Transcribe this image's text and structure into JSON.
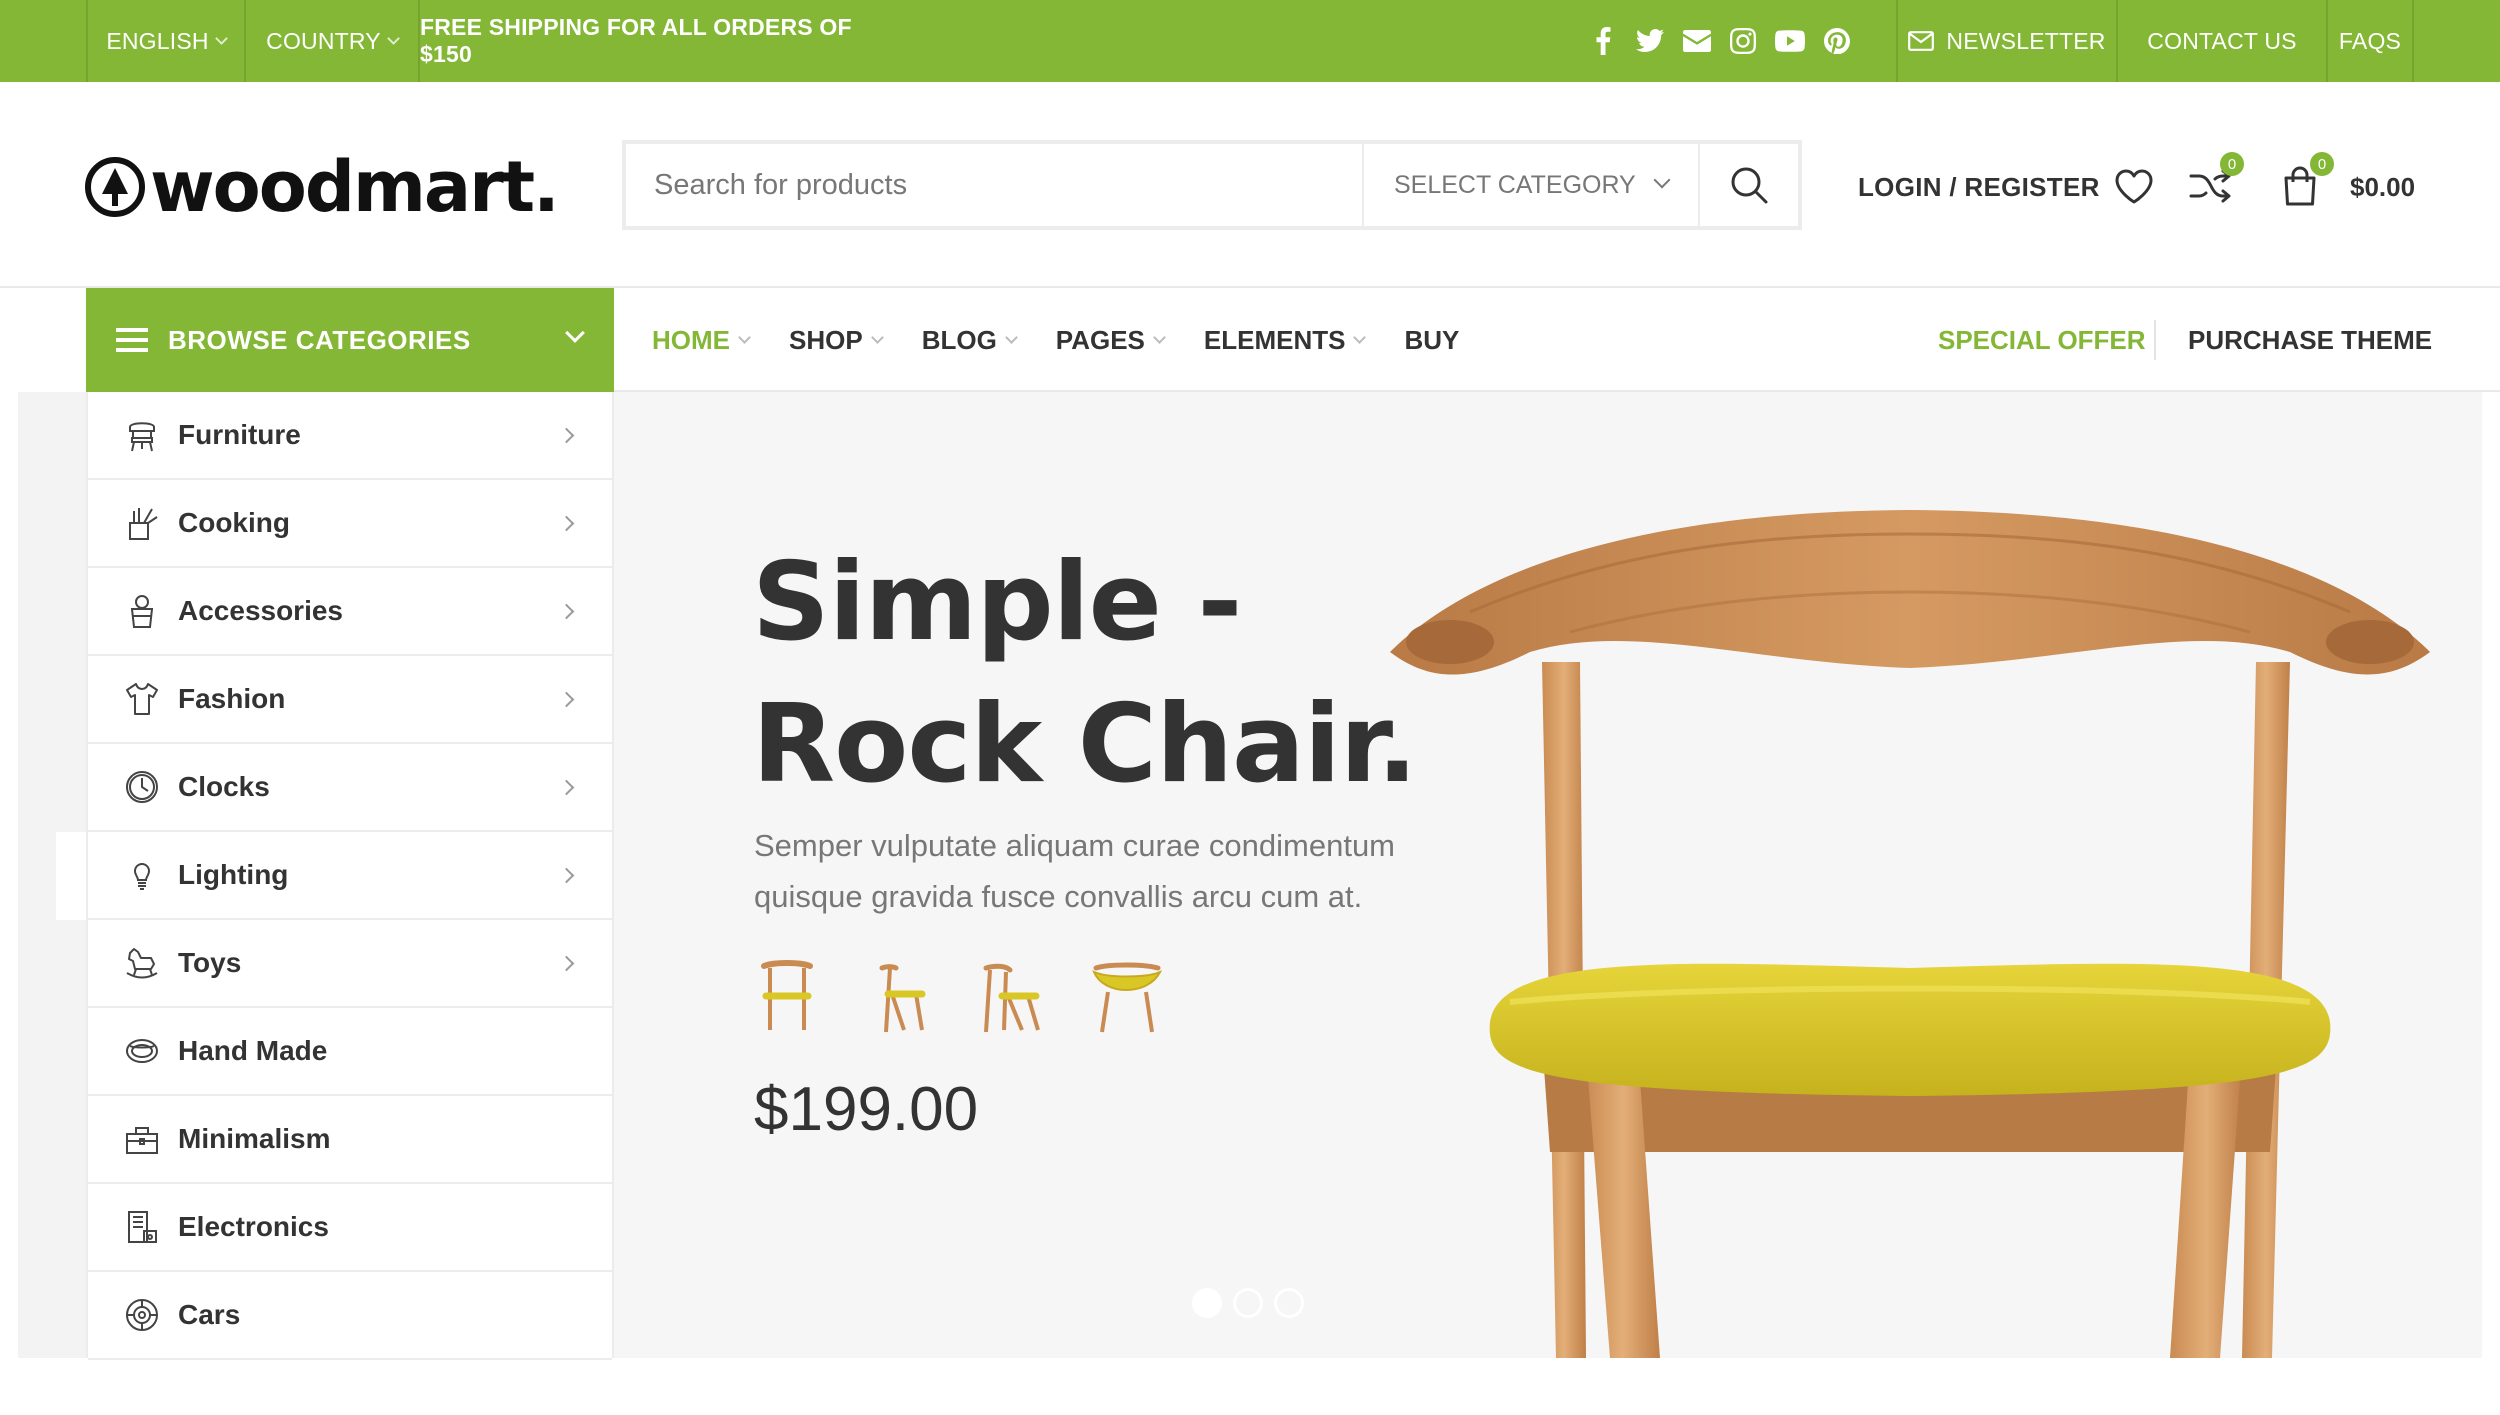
{
  "topbar": {
    "language": "ENGLISH",
    "country": "COUNTRY",
    "shipping": "FREE SHIPPING FOR ALL ORDERS OF $150",
    "socials": [
      "facebook-icon",
      "twitter-icon",
      "email-icon",
      "instagram-icon",
      "youtube-icon",
      "pinterest-icon"
    ],
    "newsletter": "NEWSLETTER",
    "contact": "CONTACT US",
    "faqs": "FAQS"
  },
  "header": {
    "logo": "woodmart.",
    "search_placeholder": "Search for products",
    "category_select": "SELECT CATEGORY",
    "login": "LOGIN / REGISTER",
    "compare_count": "0",
    "cart_count": "0",
    "cart_total": "$0.00"
  },
  "browse": {
    "label": "BROWSE CATEGORIES"
  },
  "nav": {
    "items": [
      {
        "label": "HOME",
        "active": true,
        "dropdown": true
      },
      {
        "label": "SHOP",
        "active": false,
        "dropdown": true
      },
      {
        "label": "BLOG",
        "active": false,
        "dropdown": true
      },
      {
        "label": "PAGES",
        "active": false,
        "dropdown": true
      },
      {
        "label": "ELEMENTS",
        "active": false,
        "dropdown": true
      },
      {
        "label": "BUY",
        "active": false,
        "dropdown": false
      }
    ],
    "special": "SPECIAL OFFER",
    "purchase": "PURCHASE THEME"
  },
  "categories": [
    {
      "label": "Furniture",
      "icon": "chair-icon",
      "arrow": true
    },
    {
      "label": "Cooking",
      "icon": "cooking-icon",
      "arrow": true
    },
    {
      "label": "Accessories",
      "icon": "accessories-icon",
      "arrow": true
    },
    {
      "label": "Fashion",
      "icon": "shirt-icon",
      "arrow": true
    },
    {
      "label": "Clocks",
      "icon": "clock-icon",
      "arrow": true
    },
    {
      "label": "Lighting",
      "icon": "bulb-icon",
      "arrow": true
    },
    {
      "label": "Toys",
      "icon": "rocking-horse-icon",
      "arrow": true
    },
    {
      "label": "Hand Made",
      "icon": "handmade-icon",
      "arrow": false
    },
    {
      "label": "Minimalism",
      "icon": "bag-icon",
      "arrow": false
    },
    {
      "label": "Electronics",
      "icon": "electronics-icon",
      "arrow": false
    },
    {
      "label": "Cars",
      "icon": "wheel-icon",
      "arrow": false
    }
  ],
  "hero": {
    "title_line1": "Simple -",
    "title_line2": "Rock Chair.",
    "description": "Semper vulputate aliquam curae condimentum quisque gravida fusce convallis arcu cum at.",
    "price": "$199.00",
    "slides": 3,
    "active_slide": 1
  },
  "colors": {
    "brand_green": "#83b735",
    "text_dark": "#333333",
    "chair_seat": "#d9c726",
    "wood": "#c98b52"
  }
}
